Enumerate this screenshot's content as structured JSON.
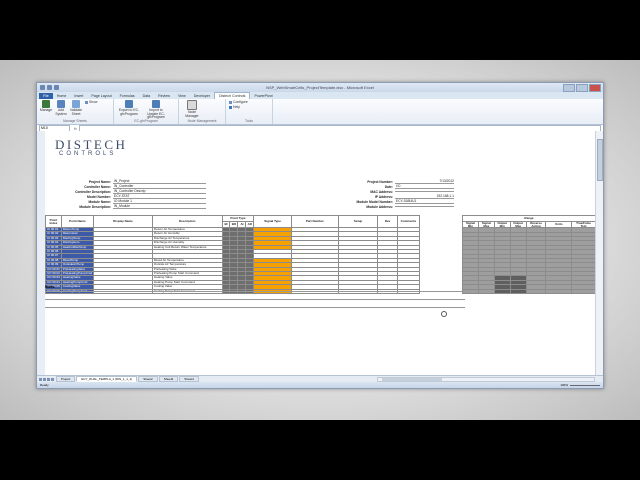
{
  "window": {
    "title": "NSP_WebSmartCells_ProjectTemplate.xlsx - Microsoft Excel"
  },
  "ribbon": {
    "tabs": [
      "File",
      "Home",
      "Insert",
      "Page Layout",
      "Formulas",
      "Data",
      "Review",
      "View",
      "Developer",
      "Distech Controls",
      "PowerPivot"
    ],
    "active_tab": "Distech Controls",
    "groups": [
      {
        "label": "Manage Sheets",
        "buttons": [
          "Manage",
          "Add System",
          "Validate Sheet"
        ],
        "small": [
          "Show"
        ]
      },
      {
        "label": "EC-gfxProgram",
        "buttons": [
          "Export to EC-gfxProgram",
          "Import to Update EC-gfxProgram"
        ],
        "small": []
      },
      {
        "label": "Node Management",
        "buttons": [
          "Node Manager"
        ],
        "small": []
      },
      {
        "label": "Tools",
        "buttons": [],
        "small": [
          "Configure",
          "Help"
        ]
      }
    ]
  },
  "formula_bar": {
    "name_box": "M10",
    "fx": "fx",
    "value": ""
  },
  "logo": {
    "line1": "DISTECH",
    "line2": "CONTROLS"
  },
  "project_info_left": [
    {
      "key": "Project Name:",
      "value": "IN_Project"
    },
    {
      "key": "Controller Name:",
      "value": "IN_Controller"
    },
    {
      "key": "Controller Description:",
      "value": "IN_Controller Descrip"
    },
    {
      "key": "Model Number:",
      "value": "ECY-STAT"
    },
    {
      "key": "Module Name:",
      "value": "IO Module 1"
    },
    {
      "key": "Module Description:",
      "value": "IN_Module"
    }
  ],
  "project_info_right": [
    {
      "key": "Project Number:",
      "value": "7/13/2012"
    },
    {
      "key": "Date:",
      "value": "I/O"
    },
    {
      "key": "MAC Address:",
      "value": ""
    },
    {
      "key": "IP Address:",
      "value": "192.168.1.1"
    },
    {
      "key": "Module Model Number:",
      "value": "ECY-SUB4U1"
    },
    {
      "key": "Module Address:",
      "value": ""
    }
  ],
  "table": {
    "headers": [
      "Point Index",
      "Point Name",
      "Display Name",
      "Description",
      "Point Type",
      "Signal Type",
      "Part Number",
      "Setup",
      "Dev",
      "Comments"
    ],
    "point_type_sub": [
      "BI",
      "BO",
      "AI",
      "AO"
    ],
    "rows": [
      {
        "index": "UI 00.01",
        "name": "ReturnTemp",
        "desc": "Return Air Temperature"
      },
      {
        "index": "UI 00.02",
        "name": "ReturnHum",
        "desc": "Return Air Humidity"
      },
      {
        "index": "UI 00.03",
        "name": "DischrgTemp",
        "desc": "Discharge Air Temperature"
      },
      {
        "index": "UI 00.04",
        "name": "DischrgHum",
        "desc": "Discharge Air Humidity"
      },
      {
        "index": "UI 00.05",
        "name": "HeatCoilRetTemp",
        "desc": "Heating Coil Return Water Temperature"
      },
      {
        "index": "UI 00.06",
        "name": "",
        "desc": ""
      },
      {
        "index": "UI 00.07",
        "name": "",
        "desc": ""
      },
      {
        "index": "UI 00.08",
        "name": "MixedTemp",
        "desc": "Mixed Air Temperature"
      },
      {
        "index": "UI 00.09",
        "name": "OutsideAirTemp",
        "desc": "Outside Air Temperature"
      },
      {
        "index": "UO 00.01",
        "name": "PreHeatingValve",
        "desc": "Preheating Valve"
      },
      {
        "index": "UO 00.02",
        "name": "PreHeatingPumpCmd",
        "desc": "Preheating Pump Start Command"
      },
      {
        "index": "UO 00.03",
        "name": "HeatingValve",
        "desc": "Heating Valve"
      },
      {
        "index": "UO 00.04",
        "name": "HeatingPumpCmd",
        "desc": "Heating Pump Start Command"
      },
      {
        "index": "UO 00.05",
        "name": "CoolingValve",
        "desc": "Cooling Valve"
      },
      {
        "index": "UO 00.06",
        "name": "CoolingPumpCmd",
        "desc": "Cooling Pump Start Command"
      }
    ]
  },
  "ranges_table": {
    "title": "Range",
    "headers": [
      "Signal Min",
      "Signal Max",
      "Output Min",
      "Output Max",
      "Reverse Acting",
      "Units",
      "True/False Text"
    ]
  },
  "notes_label": "Notes:",
  "sheet_tabs": [
    "Project",
    "ECY_DUAL_TEMPLA_1 (DIN_1_1_1)",
    "Sheet2",
    "Sheet3",
    "Sheet4"
  ],
  "active_sheet_tab": "ECY_DUAL_TEMPLA_1 (DIN_1_1_1)",
  "status": {
    "left": "Ready",
    "zoom": "100%"
  },
  "column_letters": [
    "A",
    "B",
    "C",
    "D",
    "E",
    "F",
    "G",
    "H",
    "I",
    "J",
    "K",
    "L",
    "M",
    "N",
    "AB",
    "AC",
    "AD",
    "AE",
    "AF",
    "AG",
    "AH"
  ],
  "selected_column": "M",
  "colors": {
    "accent_orange": "#f7a100",
    "header_blue": "#3d5aa8",
    "gray": "#6e6e6e"
  }
}
